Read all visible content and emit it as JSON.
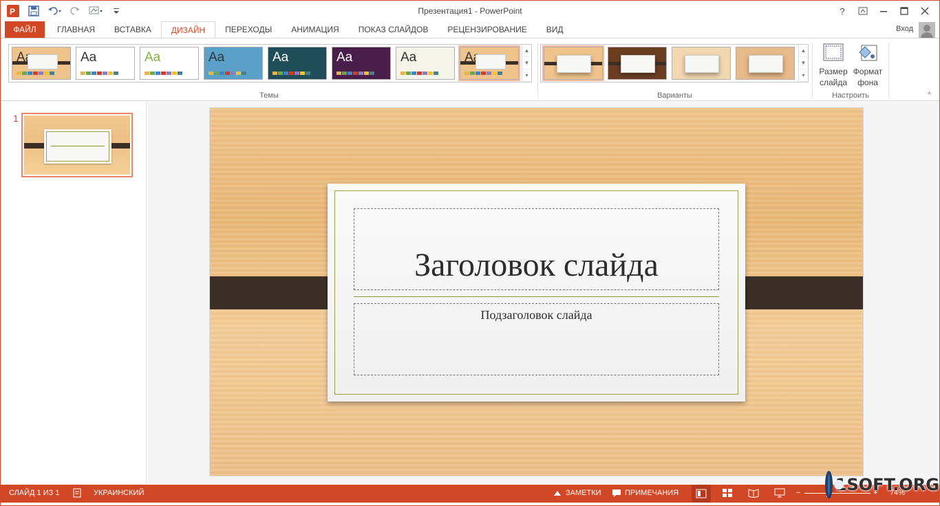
{
  "window": {
    "title": "Презентация1 - PowerPoint",
    "help": "?",
    "controls": [
      "ribbon-options",
      "minimize",
      "maximize",
      "close"
    ]
  },
  "tabs": {
    "file": "ФАЙЛ",
    "items": [
      "ГЛАВНАЯ",
      "ВСТАВКА",
      "ДИЗАЙН",
      "ПЕРЕХОДЫ",
      "АНИМАЦИЯ",
      "ПОКАЗ СЛАЙДОВ",
      "РЕЦЕНЗИРОВАНИЕ",
      "ВИД"
    ],
    "active": "ДИЗАЙН",
    "signin": "Вход"
  },
  "ribbon": {
    "themes": {
      "label": "Темы",
      "items": [
        {
          "aa": "Aa",
          "bg": "#efc48c",
          "fg": "#333333"
        },
        {
          "aa": "Aa",
          "bg": "#ffffff",
          "fg": "#333333"
        },
        {
          "aa": "Aa",
          "bg": "#ffffff",
          "fg": "#7cb342"
        },
        {
          "aa": "Aa",
          "bg": "#5aa0c8",
          "fg": "#333333"
        },
        {
          "aa": "Aa",
          "bg": "#1f4e5a",
          "fg": "#ffffff"
        },
        {
          "aa": "Aa",
          "bg": "#4a1e4a",
          "fg": "#ffffff"
        },
        {
          "aa": "Aa",
          "bg": "#f4f4ea",
          "fg": "#333333"
        },
        {
          "aa": "Aa",
          "bg": "#efc48c",
          "fg": "#333333"
        }
      ]
    },
    "variants": {
      "label": "Варианты",
      "items": [
        {
          "bg": "#efc48c"
        },
        {
          "bg": "#6b3e22"
        },
        {
          "bg": "#f2d7b0"
        },
        {
          "bg": "#e8b98a"
        }
      ]
    },
    "customize": {
      "label": "Настроить",
      "slide_size": "Размер слайда",
      "format_background": "Формат фона"
    }
  },
  "slides_pane": {
    "slide_number": "1"
  },
  "slide": {
    "title": "Заголовок слайда",
    "subtitle": "Подзаголовок слайда"
  },
  "statusbar": {
    "slide_info": "СЛАЙД 1 ИЗ 1",
    "language": "УКРАИНСКИЙ",
    "notes": "ЗАМЕТКИ",
    "comments": "ПРИМЕЧАНИЯ",
    "zoom": "74%"
  },
  "watermark": "1SOFT.ORG",
  "colors": {
    "accent": "#d24726",
    "strap": "#3b2f27"
  }
}
